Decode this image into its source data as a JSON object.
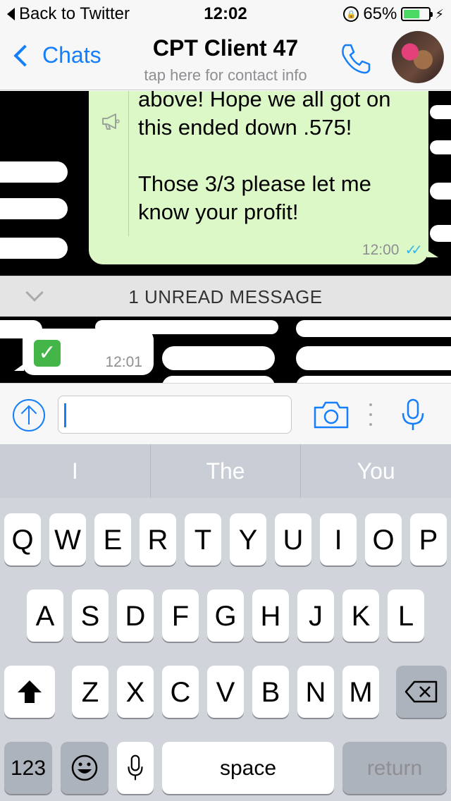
{
  "status_bar": {
    "back_label": "Back to Twitter",
    "time": "12:02",
    "battery_text": "65%",
    "battery_level": 0.65
  },
  "nav": {
    "back_label": "Chats",
    "title": "CPT Client 47",
    "subtitle": "tap here for contact info"
  },
  "messages": [
    {
      "direction": "outgoing",
      "line1": "above! Hope we all got on",
      "line2": "this ended down .575!",
      "line3": "Those 3/3 please let me",
      "line4": "know your profit!",
      "time": "12:00"
    },
    {
      "direction": "incoming",
      "content": "✅",
      "time": "12:01"
    }
  ],
  "unread_banner": "1 UNREAD MESSAGE",
  "composer": {
    "value": "",
    "placeholder": ""
  },
  "keyboard": {
    "suggestions": [
      "I",
      "The",
      "You"
    ],
    "row1": [
      "Q",
      "W",
      "E",
      "R",
      "T",
      "Y",
      "U",
      "I",
      "O",
      "P"
    ],
    "row2": [
      "A",
      "S",
      "D",
      "F",
      "G",
      "H",
      "J",
      "K",
      "L"
    ],
    "row3": [
      "Z",
      "X",
      "C",
      "V",
      "B",
      "N",
      "M"
    ],
    "numbers_label": "123",
    "space_label": "space",
    "return_label": "return"
  },
  "colors": {
    "accent": "#147efb",
    "outgoing_bubble": "#dcf8c6",
    "read_ticks": "#34b7f1"
  }
}
